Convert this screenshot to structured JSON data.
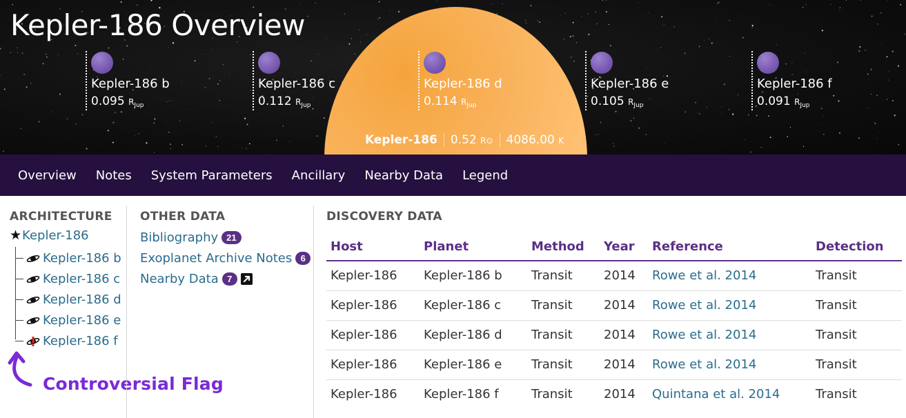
{
  "header": {
    "title": "Kepler-186 Overview",
    "planets": [
      {
        "name": "Kepler-186 b",
        "radius": "0.095",
        "unit": "R",
        "unit_sub": "Jup"
      },
      {
        "name": "Kepler-186 c",
        "radius": "0.112",
        "unit": "R",
        "unit_sub": "Jup"
      },
      {
        "name": "Kepler-186 d",
        "radius": "0.114",
        "unit": "R",
        "unit_sub": "Jup"
      },
      {
        "name": "Kepler-186 e",
        "radius": "0.105",
        "unit": "R",
        "unit_sub": "Jup"
      },
      {
        "name": "Kepler-186 f",
        "radius": "0.091",
        "unit": "R",
        "unit_sub": "Jup"
      }
    ],
    "star": {
      "name": "Kepler-186",
      "radius": "0.52",
      "radius_unit": "R⊙",
      "temp": "4086.00",
      "temp_unit": "K"
    }
  },
  "colors": {
    "nav_bg": "#26103f",
    "accent": "#5b2f86",
    "link": "#2a6c8c",
    "star": "#ffc173",
    "planet": "#7a5cb3",
    "callout": "#7a2ad6"
  },
  "nav": {
    "items": [
      "Overview",
      "Notes",
      "System Parameters",
      "Ancillary",
      "Nearby Data",
      "Legend"
    ]
  },
  "architecture": {
    "heading": "ARCHITECTURE",
    "root": "Kepler-186",
    "root_icon": "star-icon",
    "items": [
      {
        "label": "Kepler-186 b",
        "icon": "planet-icon"
      },
      {
        "label": "Kepler-186 c",
        "icon": "planet-icon"
      },
      {
        "label": "Kepler-186 d",
        "icon": "planet-icon"
      },
      {
        "label": "Kepler-186 e",
        "icon": "planet-icon"
      },
      {
        "label": "Kepler-186 f",
        "icon": "controversial-planet-icon"
      }
    ],
    "callout": "Controversial Flag"
  },
  "other_data": {
    "heading": "OTHER DATA",
    "items": [
      {
        "label": "Bibliography",
        "count": "21"
      },
      {
        "label": "Exoplanet Archive Notes",
        "count": "6"
      },
      {
        "label": "Nearby Data",
        "count": "7",
        "icon": "external-link-icon"
      }
    ]
  },
  "discovery": {
    "heading": "DISCOVERY DATA",
    "columns": [
      "Host",
      "Planet",
      "Method",
      "Year",
      "Reference",
      "Detection"
    ],
    "rows": [
      [
        "Kepler-186",
        "Kepler-186 b",
        "Transit",
        "2014",
        "Rowe et al. 2014",
        "Transit"
      ],
      [
        "Kepler-186",
        "Kepler-186 c",
        "Transit",
        "2014",
        "Rowe et al. 2014",
        "Transit"
      ],
      [
        "Kepler-186",
        "Kepler-186 d",
        "Transit",
        "2014",
        "Rowe et al. 2014",
        "Transit"
      ],
      [
        "Kepler-186",
        "Kepler-186 e",
        "Transit",
        "2014",
        "Rowe et al. 2014",
        "Transit"
      ],
      [
        "Kepler-186",
        "Kepler-186 f",
        "Transit",
        "2014",
        "Quintana et al. 2014",
        "Transit"
      ]
    ]
  }
}
